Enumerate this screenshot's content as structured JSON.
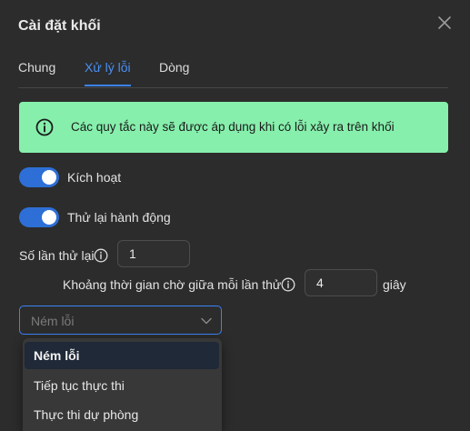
{
  "dialog": {
    "title": "Cài đặt khối",
    "close_icon": "close-icon"
  },
  "tabs": [
    {
      "label": "Chung",
      "active": false
    },
    {
      "label": "Xử lý lỗi",
      "active": true
    },
    {
      "label": "Dòng",
      "active": false
    }
  ],
  "alert": {
    "icon": "info-icon",
    "text": "Các quy tắc này sẽ được áp dụng khi có lỗi xảy ra trên khối",
    "background": "#86efac"
  },
  "toggles": [
    {
      "label": "Kích hoạt",
      "on": true
    },
    {
      "label": "Thử lại hành động",
      "on": true
    }
  ],
  "retry": {
    "count_label": "Số lần thử lại",
    "count_value": "1",
    "interval_label": "Khoảng thời gian chờ giữa mỗi lần thử",
    "interval_value": "4",
    "interval_unit": "giây"
  },
  "error_action": {
    "placeholder": "Ném lỗi",
    "options": [
      "Ném lỗi",
      "Tiếp tục thực thi",
      "Thực thi dự phòng"
    ],
    "selected_index": 0
  },
  "colors": {
    "accent": "#3b82f6",
    "toggle_on": "#2d6fd6",
    "background": "#2c2c2c",
    "alert": "#86efac"
  }
}
